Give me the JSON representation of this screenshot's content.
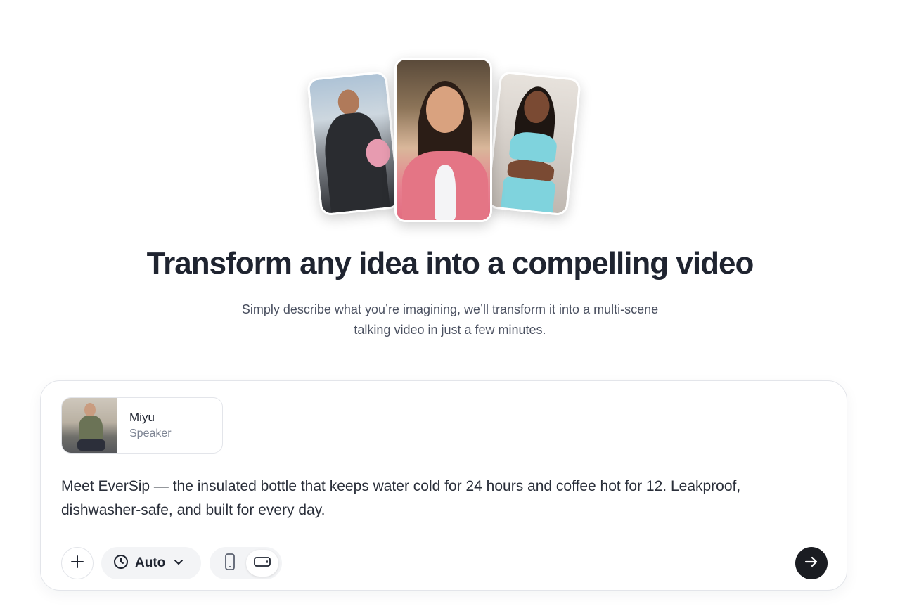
{
  "hero": {
    "title": "Transform any idea into a compelling video",
    "subtitle_line1": "Simply describe what you’re imagining, we’ll transform it into a multi-scene",
    "subtitle_line2": "talking video in just a few minutes."
  },
  "speaker": {
    "name": "Miyu",
    "role": "Speaker"
  },
  "prompt": {
    "text": "Meet EverSip — the insulated bottle that keeps water cold for 24 hours and coffee hot for 12. Leakproof, dishwasher-safe, and built for every day."
  },
  "toolbar": {
    "duration_label": "Auto",
    "orientation_selected": "landscape"
  },
  "icons": {
    "add": "plus-icon",
    "duration": "clock-icon",
    "dropdown": "chevron-down-icon",
    "portrait": "phone-portrait-icon",
    "landscape": "phone-landscape-icon",
    "submit": "arrow-right-icon"
  },
  "colors": {
    "submit_bg": "#1b1d22",
    "caret": "#2aa7e0",
    "title": "#1f2430"
  }
}
